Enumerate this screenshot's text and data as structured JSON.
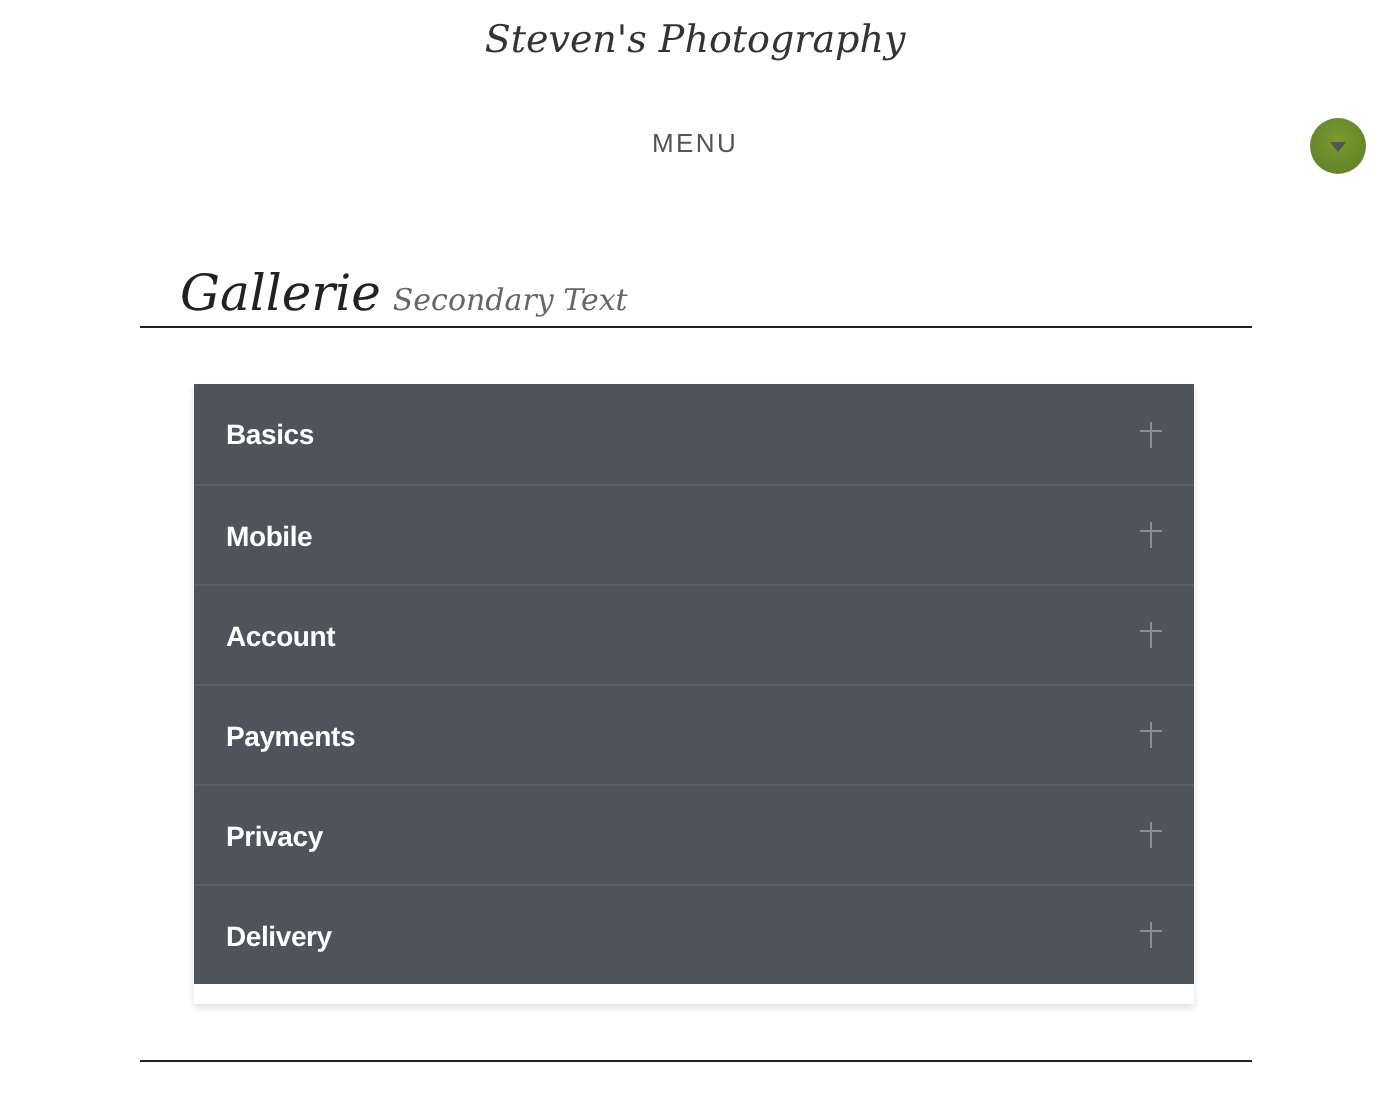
{
  "site_title": "Steven's Photography",
  "menu": {
    "label": "MENU"
  },
  "section": {
    "title": "Gallerie",
    "subtitle": "Secondary Text"
  },
  "accordion": [
    {
      "label": "Basics",
      "expanded": false
    },
    {
      "label": "Mobile",
      "expanded": false
    },
    {
      "label": "Account",
      "expanded": false
    },
    {
      "label": "Payments",
      "expanded": false
    },
    {
      "label": "Privacy",
      "expanded": false
    },
    {
      "label": "Delivery",
      "expanded": false
    }
  ]
}
